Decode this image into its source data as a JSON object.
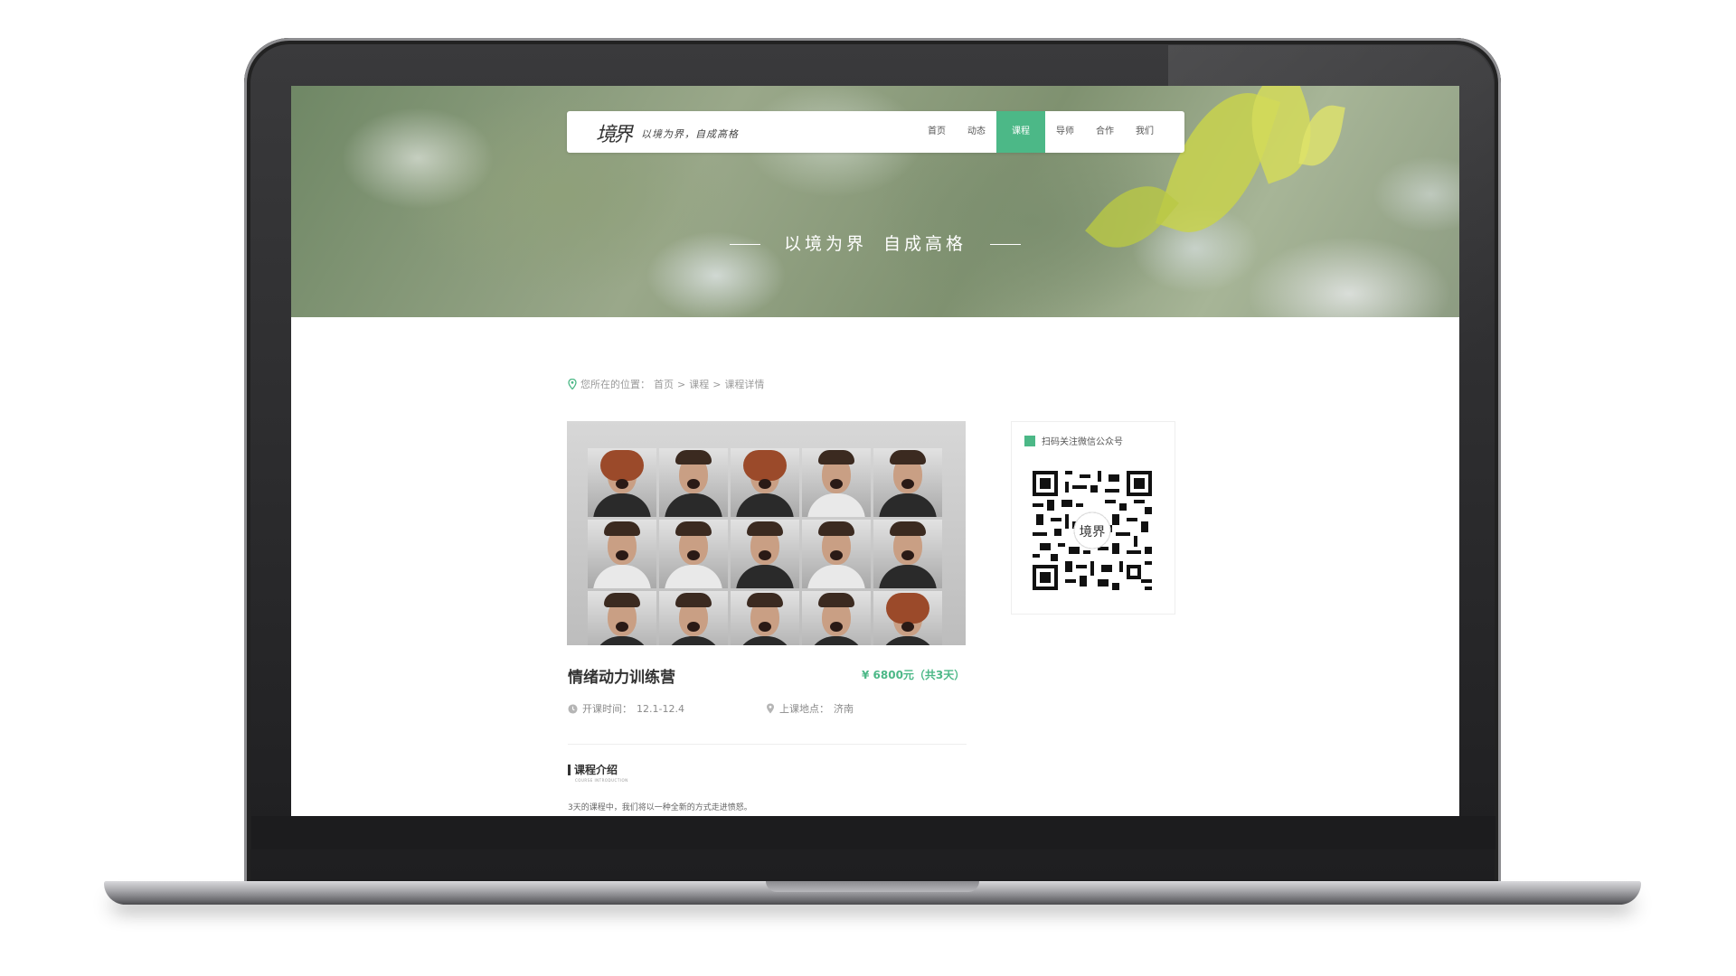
{
  "nav": {
    "logo": "境界",
    "tagline": "以境为界，自成高格",
    "items": [
      {
        "label": "首页",
        "active": false
      },
      {
        "label": "动态",
        "active": false
      },
      {
        "label": "课程",
        "active": true
      },
      {
        "label": "导师",
        "active": false
      },
      {
        "label": "合作",
        "active": false
      },
      {
        "label": "我们",
        "active": false
      }
    ]
  },
  "hero": {
    "slogan_left": "以境为界",
    "slogan_right": "自成高格"
  },
  "breadcrumb": {
    "prefix": "您所在的位置：",
    "home": "首页",
    "sep": ">",
    "courses": "课程",
    "current": "课程详情"
  },
  "course": {
    "title": "情绪动力训练营",
    "price": "¥ 6800元（共3天）",
    "time_label": "开课时间：",
    "time_value": "12.1-12.4",
    "place_label": "上课地点：",
    "place_value": "济南",
    "image_icon": "photo-grid-faces"
  },
  "intro": {
    "title": "课程介绍",
    "subtitle": "COURSE INTRODUCTION",
    "text": "3天的课程中，我们将以一种全新的方式走进愤怒。"
  },
  "qr": {
    "title": "扫码关注微信公众号",
    "center_logo": "境界"
  },
  "colors": {
    "accent": "#4cb887",
    "text": "#333333",
    "muted": "#9a9a9a"
  }
}
